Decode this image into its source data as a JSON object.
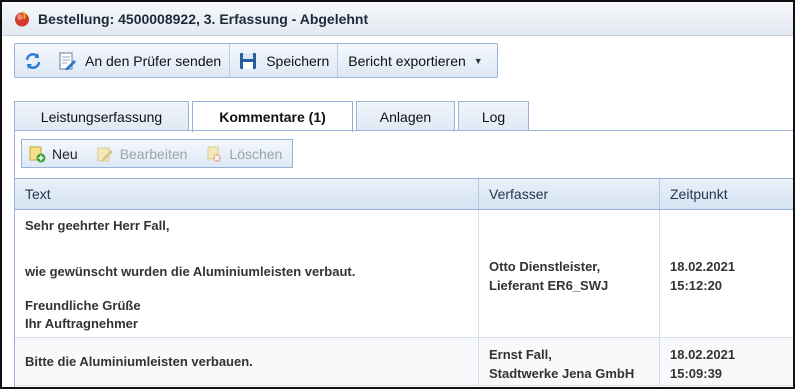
{
  "window": {
    "title": "Bestellung: 4500008922, 3. Erfassung - Abgelehnt"
  },
  "toolbar": {
    "refresh_icon": "refresh-icon",
    "send_label": "An den Prüfer senden",
    "save_label": "Speichern",
    "export_label": "Bericht exportieren"
  },
  "tabs": [
    {
      "label": "Leistungserfassung",
      "active": false
    },
    {
      "label": "Kommentare (1)",
      "active": true
    },
    {
      "label": "Anlagen",
      "active": false
    },
    {
      "label": "Log",
      "active": false
    }
  ],
  "comment_toolbar": {
    "new_label": "Neu",
    "edit_label": "Bearbeiten",
    "delete_label": "Löschen"
  },
  "grid": {
    "headers": {
      "text": "Text",
      "author": "Verfasser",
      "time": "Zeitpunkt"
    },
    "rows": [
      {
        "text_lines": [
          "Sehr geehrter Herr Fall,",
          "wie gewünscht wurden die Aluminiumleisten verbaut.",
          "Freundliche Grüße",
          "Ihr Auftragnehmer"
        ],
        "author_lines": [
          "Otto Dienstleister,",
          "Lieferant ER6_SWJ"
        ],
        "date": "18.02.2021",
        "time": "15:12:20"
      },
      {
        "text_lines": [
          "Bitte die Aluminiumleisten verbauen."
        ],
        "author_lines": [
          "Ernst Fall,",
          "Stadtwerke Jena GmbH"
        ],
        "date": "18.02.2021",
        "time": "15:09:39"
      }
    ]
  },
  "colors": {
    "accent": "#99b4d6",
    "header_text": "#1f3550",
    "disabled_text": "#9aa3ad"
  }
}
